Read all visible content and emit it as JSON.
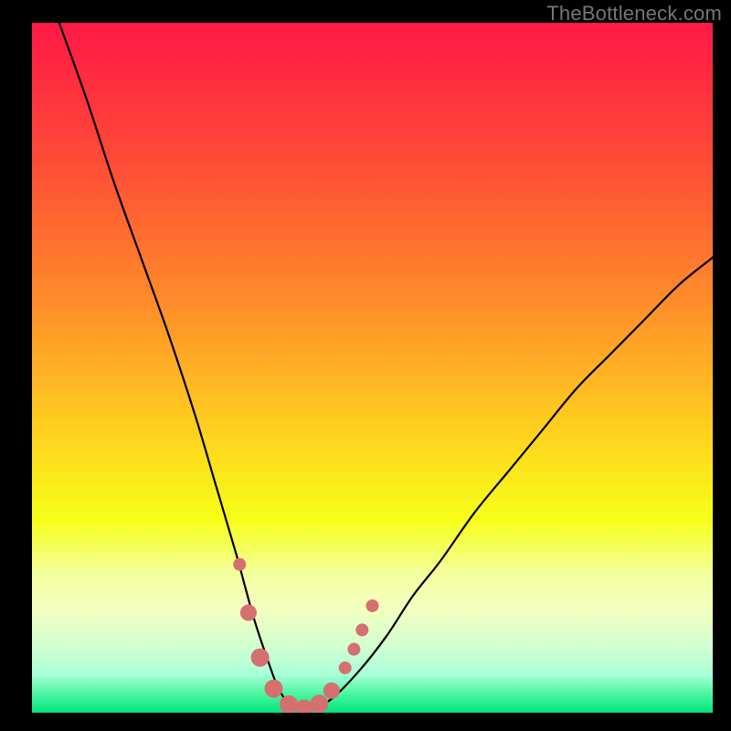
{
  "watermark": "TheBottleneck.com",
  "chart_data": {
    "type": "line",
    "title": "",
    "xlabel": "",
    "ylabel": "",
    "xlim": [
      0,
      100
    ],
    "ylim": [
      0,
      100
    ],
    "background_gradient": {
      "stops": [
        {
          "offset": 0.0,
          "color": "#ff1846"
        },
        {
          "offset": 0.2,
          "color": "#ff4b36"
        },
        {
          "offset": 0.4,
          "color": "#ff8b2a"
        },
        {
          "offset": 0.6,
          "color": "#ffd41f"
        },
        {
          "offset": 0.72,
          "color": "#f6ff18"
        },
        {
          "offset": 0.8,
          "color": "#f3ffa0"
        },
        {
          "offset": 0.85,
          "color": "#f3ffbf"
        },
        {
          "offset": 0.9,
          "color": "#d4ffcf"
        },
        {
          "offset": 0.945,
          "color": "#a8ffd8"
        },
        {
          "offset": 0.975,
          "color": "#44f59d"
        },
        {
          "offset": 1.0,
          "color": "#00e47a"
        }
      ]
    },
    "series": [
      {
        "name": "bottleneck-curve",
        "x": [
          4,
          8,
          12,
          16,
          20,
          24,
          27,
          30,
          32.5,
          34.5,
          36,
          37.5,
          39,
          41,
          44,
          48,
          52,
          56,
          60,
          65,
          70,
          75,
          80,
          85,
          90,
          95,
          100,
          105
        ],
        "y": [
          100,
          89,
          77,
          66,
          55,
          43,
          33,
          23,
          14,
          8,
          4,
          1.5,
          0.5,
          0.5,
          2,
          6,
          11,
          17,
          22,
          29,
          35,
          41,
          47,
          52,
          57,
          62,
          66,
          70
        ]
      }
    ],
    "markers": {
      "name": "highlight-points",
      "color": "#d66f6f",
      "points": [
        {
          "x": 30.5,
          "y": 21.5,
          "r": 7
        },
        {
          "x": 31.8,
          "y": 14.5,
          "r": 9
        },
        {
          "x": 33.5,
          "y": 8,
          "r": 10
        },
        {
          "x": 35.5,
          "y": 3.5,
          "r": 10
        },
        {
          "x": 37.7,
          "y": 1.2,
          "r": 10
        },
        {
          "x": 40.0,
          "y": 0.6,
          "r": 10
        },
        {
          "x": 42.2,
          "y": 1.3,
          "r": 10
        },
        {
          "x": 44.0,
          "y": 3.2,
          "r": 9
        },
        {
          "x": 46.0,
          "y": 6.5,
          "r": 7
        },
        {
          "x": 47.3,
          "y": 9.2,
          "r": 7
        },
        {
          "x": 48.5,
          "y": 12.0,
          "r": 7
        },
        {
          "x": 50.0,
          "y": 15.5,
          "r": 7
        }
      ]
    }
  }
}
